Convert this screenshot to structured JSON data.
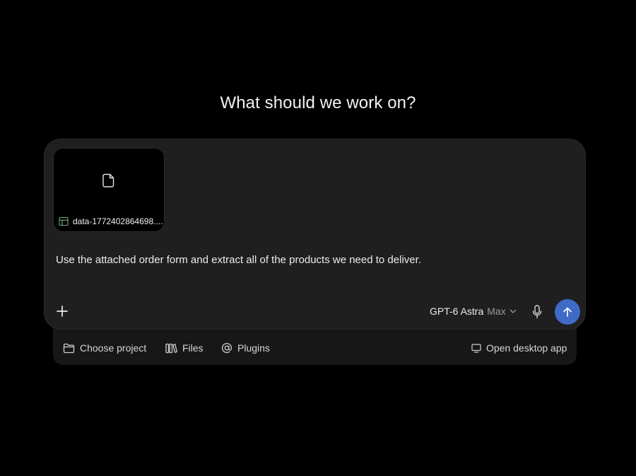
{
  "heading": "What should we work on?",
  "attachment": {
    "file_name": "data-1772402864698....",
    "file_icon": "document-icon",
    "type_icon": "spreadsheet-icon"
  },
  "composer": {
    "prompt": "Use the attached order form and extract all of the products we need to deliver.",
    "add_icon": "plus-icon",
    "model_name": "GPT-6 Astra",
    "model_tier": "Max",
    "mic_icon": "microphone-icon",
    "send_icon": "arrow-up-icon"
  },
  "actions": {
    "choose_project": "Choose project",
    "files": "Files",
    "plugins": "Plugins",
    "open_desktop_app": "Open desktop app"
  },
  "colors": {
    "background": "#000000",
    "composer": "#1f1f1f",
    "send_button": "#3e6bc6",
    "spreadsheet_icon": "#6fae7a"
  }
}
